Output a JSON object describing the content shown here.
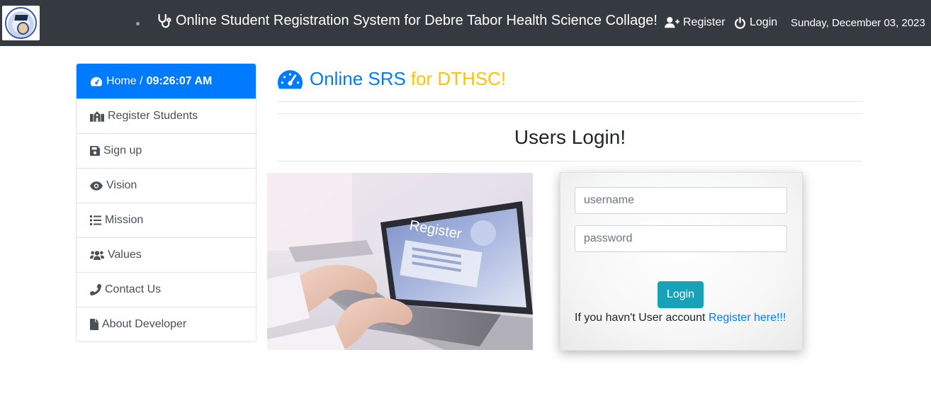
{
  "navbar": {
    "brand_text": "Online Student Registration System for Debre Tabor Health Science Collage!",
    "register_label": "Register",
    "login_label": "Login",
    "date": "Sunday, December 03, 2023"
  },
  "sidebar": {
    "home_label": "Home /",
    "clock": "09:26:07 AM",
    "items": [
      {
        "label": "Register Students",
        "icon": "school-icon"
      },
      {
        "label": "Sign up",
        "icon": "save-icon"
      },
      {
        "label": "Vision",
        "icon": "eye-icon"
      },
      {
        "label": "Mission",
        "icon": "list-icon"
      },
      {
        "label": "Values",
        "icon": "users-icon"
      },
      {
        "label": "Contact Us",
        "icon": "phone-icon"
      },
      {
        "label": "About Developer",
        "icon": "file-icon"
      }
    ]
  },
  "main": {
    "title_primary": "Online SRS",
    "title_secondary": "for DTHSC!",
    "login_heading": "Users Login!",
    "hero_image_text": "Register"
  },
  "login_form": {
    "username_placeholder": "username",
    "password_placeholder": "password",
    "username_value": "",
    "password_value": "",
    "button_label": "Login",
    "register_prompt": "If you havn't User account",
    "register_link": "Register here!!!"
  },
  "colors": {
    "navbar_bg": "#343a40",
    "primary": "#007bff",
    "accent": "#ffc107",
    "login_button": "#17a2b8"
  }
}
